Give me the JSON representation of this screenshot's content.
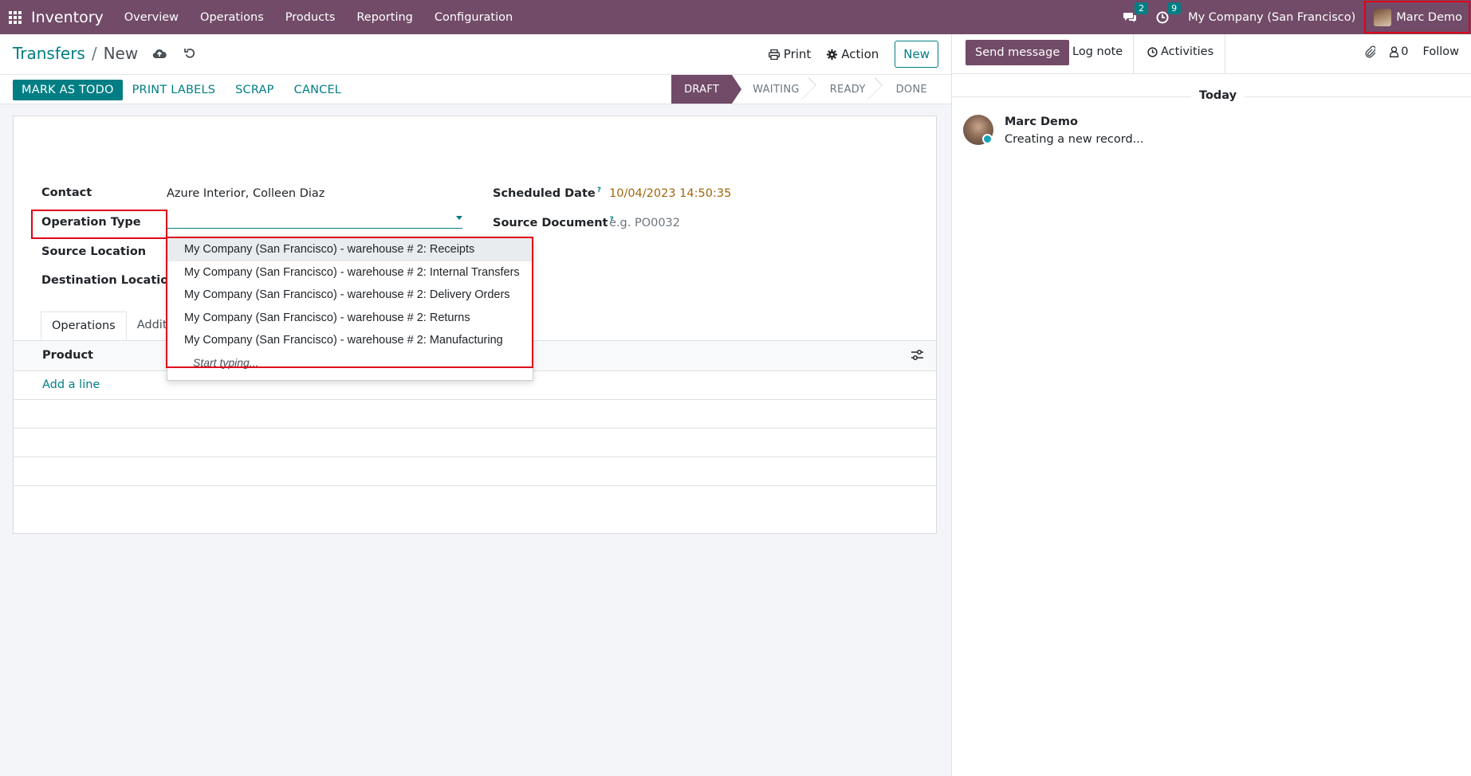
{
  "nav": {
    "app_name": "Inventory",
    "menu": [
      "Overview",
      "Operations",
      "Products",
      "Reporting",
      "Configuration"
    ],
    "messages_badge": "2",
    "activities_badge": "9",
    "company": "My Company (San Francisco)",
    "user": "Marc Demo"
  },
  "breadcrumb": {
    "parent": "Transfers",
    "separator": "/",
    "current": "New"
  },
  "control": {
    "print": "Print",
    "action": "Action",
    "new": "New"
  },
  "statusbar": {
    "buttons": {
      "primary": "MARK AS TODO",
      "print_labels": "PRINT LABELS",
      "scrap": "SCRAP",
      "cancel": "CANCEL"
    },
    "stages": [
      "DRAFT",
      "WAITING",
      "READY",
      "DONE"
    ],
    "active_stage": "DRAFT"
  },
  "form": {
    "contact_label": "Contact",
    "contact_value": "Azure Interior, Colleen Diaz",
    "operation_type_label": "Operation Type",
    "source_location_label": "Source Location",
    "destination_location_label": "Destination Location",
    "scheduled_date_label": "Scheduled Date",
    "scheduled_date_help": "?",
    "scheduled_date_value": "10/04/2023 14:50:35",
    "source_document_label": "Source Document",
    "source_document_help": "?",
    "source_document_placeholder": "e.g. PO0032"
  },
  "tabs": [
    "Operations",
    "Additi"
  ],
  "table": {
    "product_header": "Product",
    "add_line": "Add a line"
  },
  "dropdown": {
    "items": [
      "My Company (San Francisco) - warehouse # 2: Receipts",
      "My Company (San Francisco) - warehouse # 2: Internal Transfers",
      "My Company (San Francisco) - warehouse # 2: Delivery Orders",
      "My Company (San Francisco) - warehouse # 2: Returns",
      "My Company (San Francisco) - warehouse # 2: Manufacturing"
    ],
    "hint": "Start typing..."
  },
  "chatter": {
    "send_message": "Send message",
    "log_note": "Log note",
    "activities": "Activities",
    "followers_count": "0",
    "follow": "Follow",
    "today": "Today",
    "message_author": "Marc Demo",
    "message_body": "Creating a new record..."
  },
  "colors": {
    "brand": "#714b67",
    "accent": "#017e84",
    "highlight_box": "#e0001b",
    "date": "#a0660d"
  }
}
